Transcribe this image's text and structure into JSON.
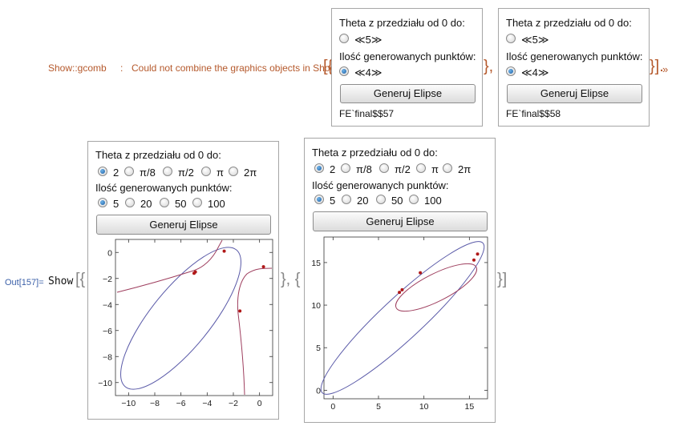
{
  "message": {
    "tag": "Show::gcomb",
    "sep": ":",
    "text": "Could not combine the graphics objects in Show",
    "open_bracket": "[{",
    "between": "}, {",
    "close_bracket": "}].",
    "more_icon": "»"
  },
  "top_panels": [
    {
      "theta_label": "Theta z przedziału od 0 do:",
      "theta_value": "≪5≫",
      "points_label": "Ilość generowanych punktów:",
      "points_value": "≪4≫",
      "button": "Generuj Elipse",
      "footer": "FE`final$$57"
    },
    {
      "theta_label": "Theta z przedziału od 0 do:",
      "theta_value": "≪5≫",
      "points_label": "Ilość generowanych punktów:",
      "points_value": "≪4≫",
      "button": "Generuj Elipse",
      "footer": "FE`final$$58"
    }
  ],
  "output": {
    "label": "Out[157]=",
    "code": "Show",
    "open": "[{",
    "between": "}, {",
    "close": "}]"
  },
  "panels": [
    {
      "theta_label": "Theta z przedziału od 0 do:",
      "theta_options": [
        "2",
        "π/8",
        "π/2",
        "π",
        "2π"
      ],
      "theta_selected": 0,
      "points_label": "Ilość generowanych punktów:",
      "points_options": [
        "5",
        "20",
        "50",
        "100"
      ],
      "points_selected": 0,
      "button": "Generuj Elipse"
    },
    {
      "theta_label": "Theta z przedziału od 0 do:",
      "theta_options": [
        "2",
        "π/8",
        "π/2",
        "π",
        "2π"
      ],
      "theta_selected": 0,
      "points_label": "Ilość generowanych punktów:",
      "points_options": [
        "5",
        "20",
        "50",
        "100"
      ],
      "points_selected": 0,
      "button": "Generuj Elipse"
    }
  ],
  "chart_data": [
    {
      "type": "line",
      "title": "",
      "xlim": [
        -11,
        1
      ],
      "ylim": [
        -11,
        1
      ],
      "xticks": [
        "-10",
        "-8",
        "-6",
        "-4",
        "-2",
        "0"
      ],
      "yticks": [
        "0",
        "-2",
        "-4",
        "-6",
        "-8",
        "-10"
      ],
      "colors": {
        "ellipse": "#5a5aa8",
        "curve": "#9e3e5e",
        "points": "#b01818"
      },
      "points": [
        [
          -4.9,
          -1.5
        ],
        [
          -5.0,
          -1.6
        ],
        [
          -2.7,
          0.1
        ],
        [
          0.3,
          -1.1
        ],
        [
          -1.5,
          -4.5
        ]
      ]
    },
    {
      "type": "line",
      "title": "",
      "xlim": [
        -1,
        17
      ],
      "ylim": [
        -1,
        18
      ],
      "xticks": [
        "0",
        "5",
        "10",
        "15"
      ],
      "yticks": [
        "15",
        "10",
        "5",
        "0"
      ],
      "colors": {
        "ellipse": "#5a5aa8",
        "curve": "#9e3e5e",
        "points": "#b01818"
      },
      "points": [
        [
          7.3,
          11.5
        ],
        [
          7.6,
          11.8
        ],
        [
          9.6,
          13.8
        ],
        [
          15.5,
          15.3
        ],
        [
          15.9,
          16.0
        ]
      ]
    }
  ]
}
